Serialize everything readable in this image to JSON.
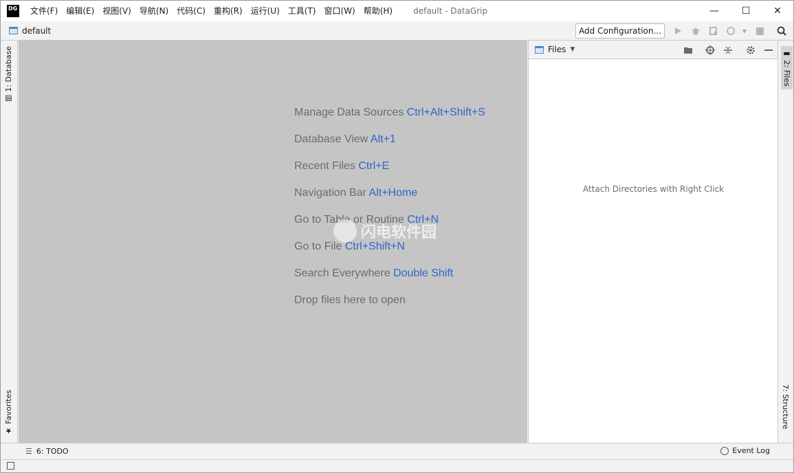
{
  "app": {
    "logo_text": "DG",
    "window_title": "default - DataGrip"
  },
  "menu": [
    {
      "label": "文件(F)"
    },
    {
      "label": "编辑(E)"
    },
    {
      "label": "视图(V)"
    },
    {
      "label": "导航(N)"
    },
    {
      "label": "代码(C)"
    },
    {
      "label": "重构(R)"
    },
    {
      "label": "运行(U)"
    },
    {
      "label": "工具(T)"
    },
    {
      "label": "窗口(W)"
    },
    {
      "label": "帮助(H)"
    }
  ],
  "window_controls": {
    "minimize": "—",
    "maximize": "☐",
    "close": "✕"
  },
  "navbar": {
    "project": "default",
    "add_configuration": "Add Configuration..."
  },
  "left_stripe": {
    "database_tab": "1: Database",
    "favorites_tab": "Favorites"
  },
  "right_stripe": {
    "files_tab": "2: Files",
    "structure_tab": "7: Structure"
  },
  "editor_hints": [
    {
      "text": "Manage Data Sources",
      "shortcut": "Ctrl+Alt+Shift+S"
    },
    {
      "text": "Database View",
      "shortcut": "Alt+1"
    },
    {
      "text": "Recent Files",
      "shortcut": "Ctrl+E"
    },
    {
      "text": "Navigation Bar",
      "shortcut": "Alt+Home"
    },
    {
      "text": "Go to Table or Routine",
      "shortcut": "Ctrl+N"
    },
    {
      "text": "Go to File",
      "shortcut": "Ctrl+Shift+N"
    },
    {
      "text": "Search Everywhere",
      "shortcut": "Double Shift"
    },
    {
      "text": "Drop files here to open",
      "shortcut": ""
    }
  ],
  "files_panel": {
    "title": "Files",
    "empty_text": "Attach Directories with Right Click"
  },
  "bottom_tools": {
    "todo": "6: TODO",
    "event_log": "Event Log"
  },
  "watermark": {
    "text": "闪电软件园"
  }
}
